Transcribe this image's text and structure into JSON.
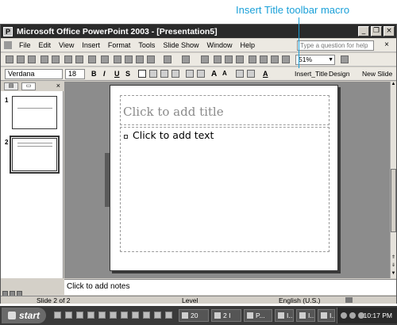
{
  "callout": {
    "text": "Insert Title toolbar macro"
  },
  "window": {
    "title": "Microsoft Office PowerPoint 2003 - [Presentation5]",
    "app_icon": "P"
  },
  "menu": {
    "items": [
      "File",
      "Edit",
      "View",
      "Insert",
      "Format",
      "Tools",
      "Slide Show",
      "Window",
      "Help"
    ],
    "help_placeholder": "Type a question for help"
  },
  "toolbar_standard": {
    "zoom": "51%"
  },
  "toolbar_formatting": {
    "font": "Verdana",
    "size": "18",
    "bold": "B",
    "italic": "I",
    "underline": "U",
    "shadow": "S",
    "grow": "A",
    "shrink": "A",
    "font_color": "A",
    "macro_button": "Insert_Title",
    "design_button": "Design",
    "new_slide_button": "New Slide"
  },
  "slides_panel": {
    "slides": [
      {
        "number": "1"
      },
      {
        "number": "2"
      }
    ]
  },
  "slide": {
    "title_placeholder": "Click to add title",
    "body_placeholder": "Click to add text"
  },
  "notes": {
    "placeholder": "Click to add notes"
  },
  "status": {
    "slide_info": "Slide 2 of 2",
    "design": "Level",
    "language": "English (U.S.)"
  },
  "taskbar": {
    "start_label": "start",
    "tasks": [
      "20",
      "2 I",
      "P...",
      "I...",
      "I...",
      "I..."
    ],
    "clock": "10:17 PM"
  },
  "colors": {
    "callout": "#1aa0d8",
    "titlebar": "#2a2a2a",
    "workspace": "#8c8c8c"
  }
}
